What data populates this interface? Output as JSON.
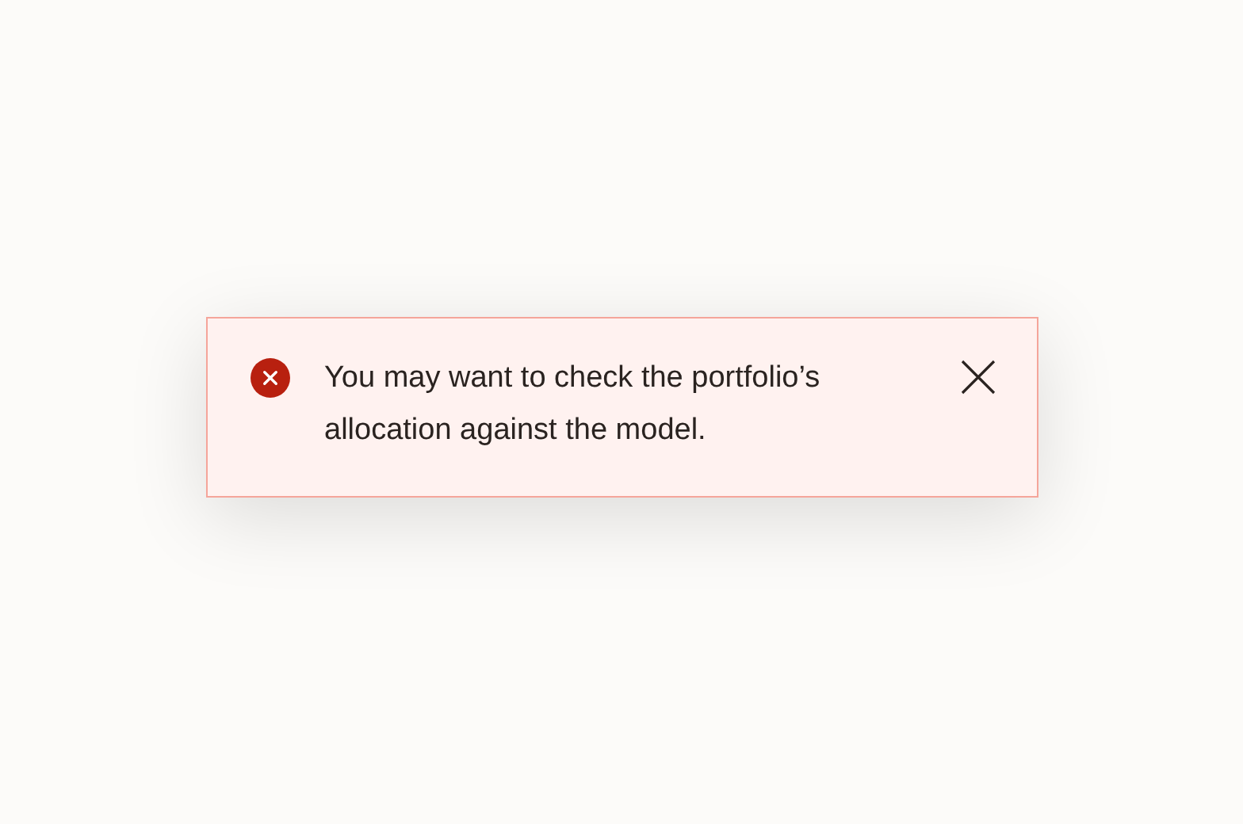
{
  "alert": {
    "kind": "error",
    "message": "You may want to check the portfolio’s allocation against the model."
  }
}
